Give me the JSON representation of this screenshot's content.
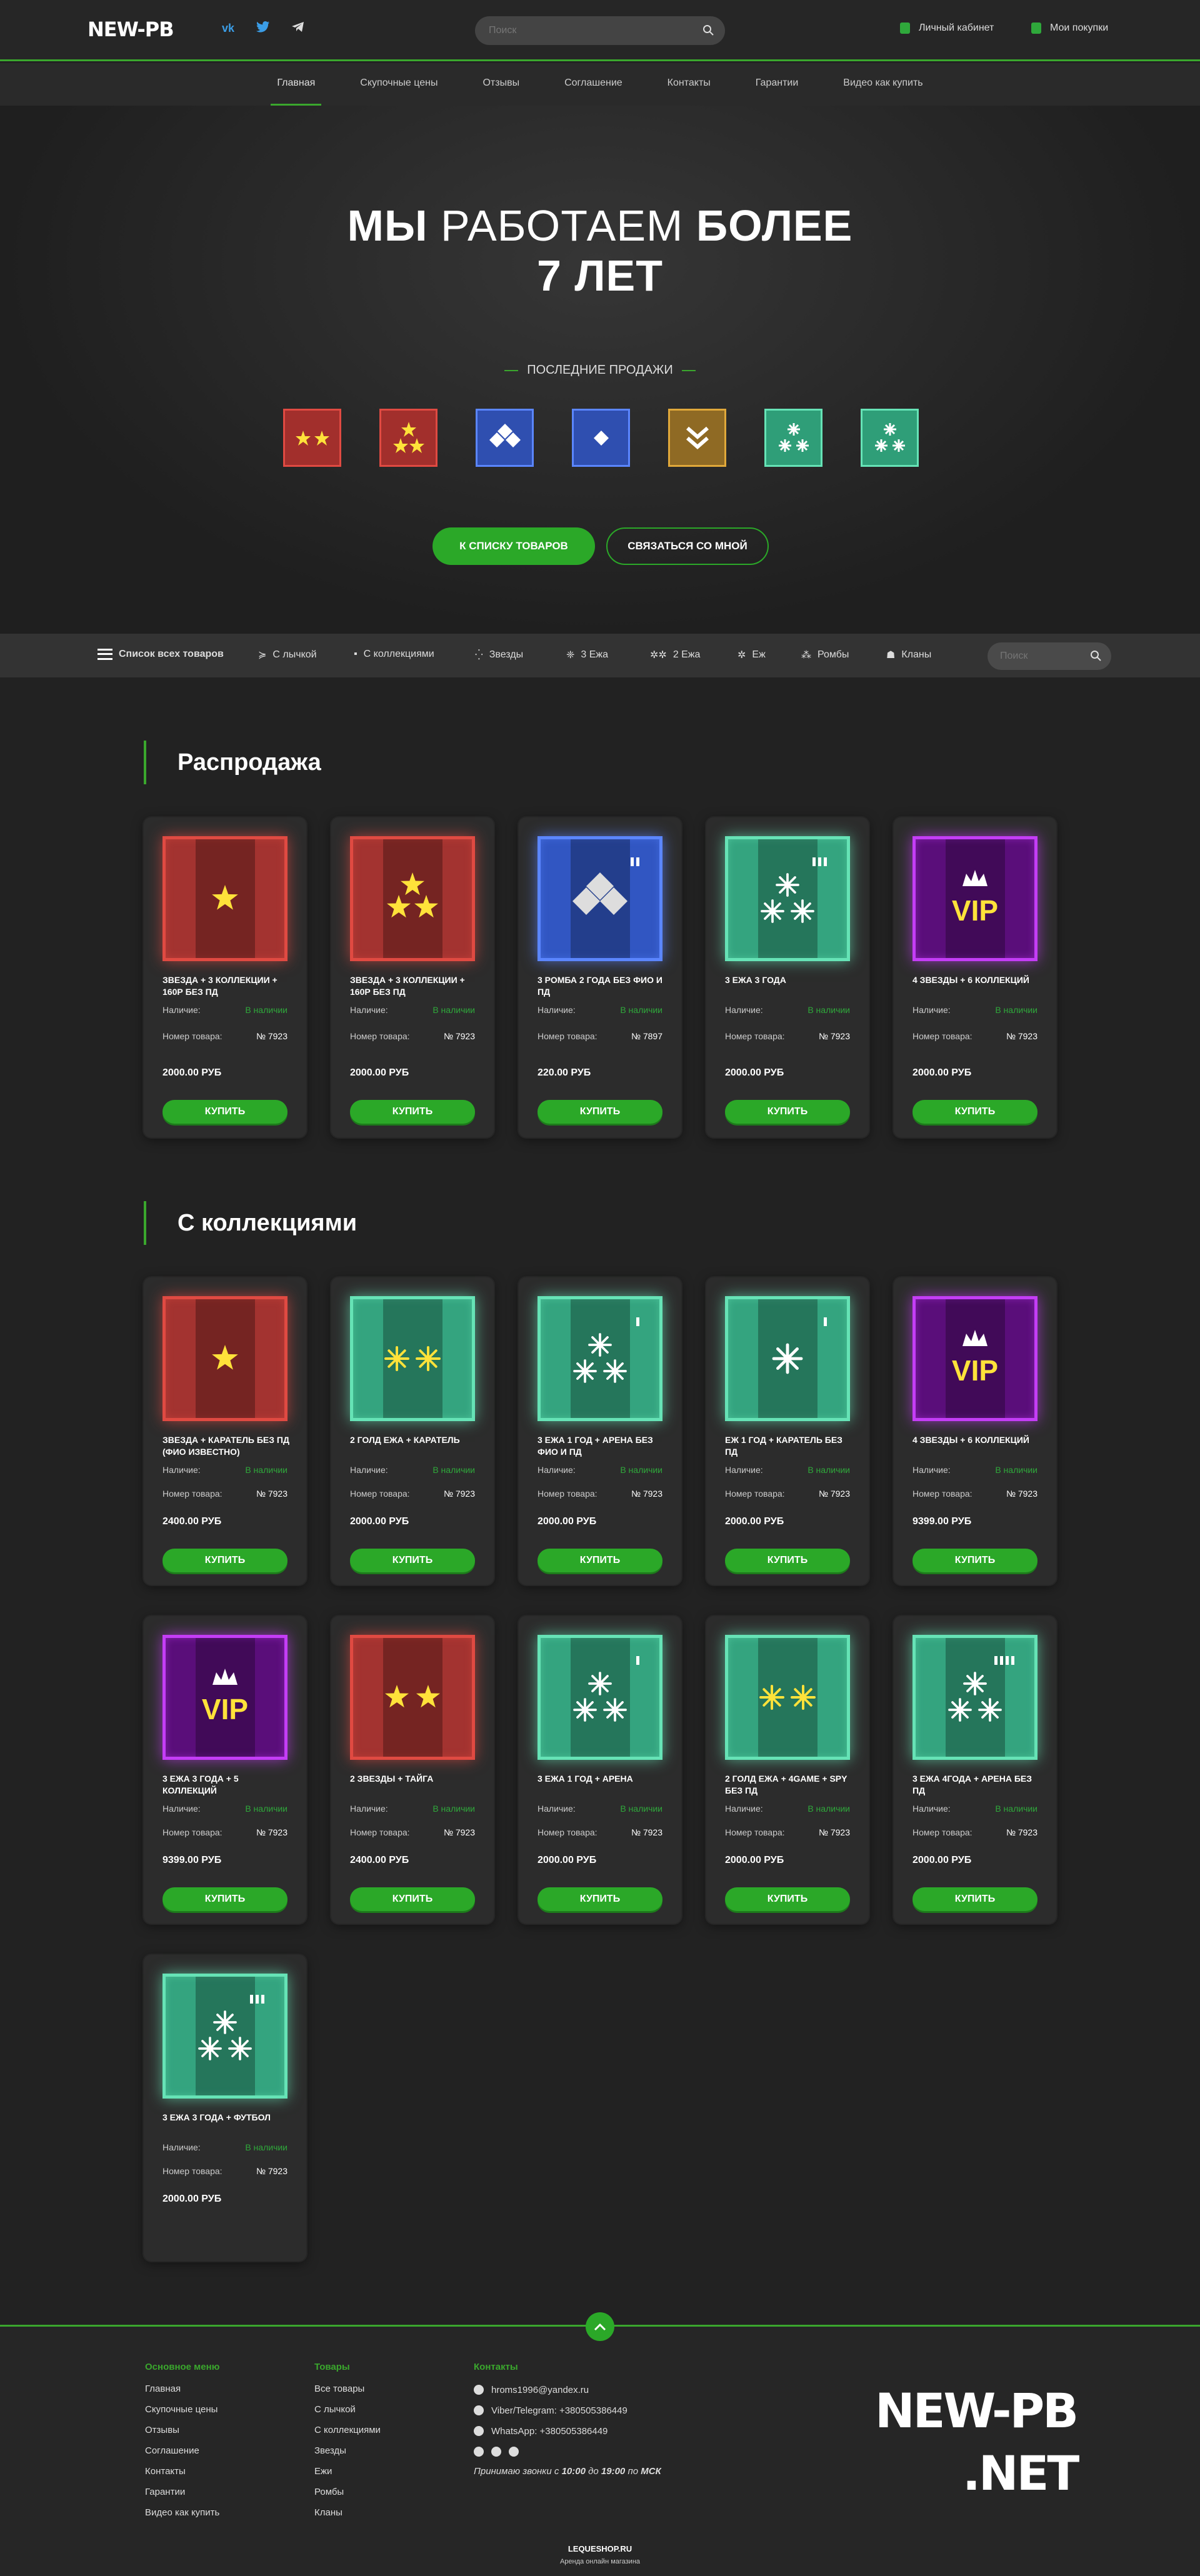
{
  "header": {
    "logo": "NEW-PB",
    "search_placeholder": "Поиск",
    "account": "Личный кабинет",
    "purchases": "Мои покупки"
  },
  "nav": [
    "Главная",
    "Скупочные цены",
    "Отзывы",
    "Соглашение",
    "Контакты",
    "Гарантии",
    "Видео как купить"
  ],
  "hero": {
    "line1_a": "МЫ",
    "line1_b": " РАБОТАЕМ ",
    "line1_c": "БОЛЕЕ",
    "line2": "7 ЛЕТ",
    "sales_title": "ПОСЛЕДНИЕ ПРОДАЖИ",
    "btn_catalog": "К СПИСКУ ТОВАРОВ",
    "btn_contact": "СВЯЗАТЬСЯ СО МНОЙ"
  },
  "categories": {
    "all": "Список всех товаров",
    "items": [
      "С лычкой",
      "С коллекциями",
      "Звезды",
      "3 Ежа",
      "2 Ежа",
      "Еж",
      "Ромбы",
      "Кланы"
    ],
    "search_placeholder": "Поиск"
  },
  "sections": {
    "sale": "Распродажа",
    "collections": "С коллекциями"
  },
  "labels": {
    "availability": "Наличие:",
    "in_stock": "В наличии",
    "item_no": "Номер товара:",
    "buy": "КУПИТЬ"
  },
  "sale_cards": [
    {
      "name": "ЗВЕЗДА + 3 КОЛЛЕКЦИИ + 160Р БЕЗ ПД",
      "num": "№ 7923",
      "price": "2000.00 РУБ"
    },
    {
      "name": "ЗВЕЗДА + 3 КОЛЛЕКЦИИ + 160Р БЕЗ ПД",
      "num": "№ 7923",
      "price": "2000.00 РУБ"
    },
    {
      "name": "3 РОМБА 2 ГОДА БЕЗ ФИО И ПД",
      "num": "№ 7897",
      "price": "220.00 РУБ"
    },
    {
      "name": "3 ЕЖА 3 ГОДА",
      "num": "№ 7923",
      "price": "2000.00 РУБ"
    },
    {
      "name": "4 ЗВЕЗДЫ + 6 КОЛЛЕКЦИЙ",
      "num": "№ 7923",
      "price": "2000.00 РУБ"
    }
  ],
  "collection_cards": [
    {
      "name": "ЗВЕЗДА + КАРАТЕЛЬ БЕЗ ПД (ФИО ИЗВЕСТНО)",
      "num": "№ 7923",
      "price": "2400.00 РУБ"
    },
    {
      "name": "2 ГОЛД ЕЖА + КАРАТЕЛЬ",
      "num": "№ 7923",
      "price": "2000.00 РУБ"
    },
    {
      "name": "3 ЕЖА 1 ГОД + АРЕНА БЕЗ ФИО И ПД",
      "num": "№ 7923",
      "price": "2000.00 РУБ"
    },
    {
      "name": "ЕЖ 1 ГОД + КАРАТЕЛЬ БЕЗ ПД",
      "num": "№ 7923",
      "price": "2000.00 РУБ"
    },
    {
      "name": "4 ЗВЕЗДЫ + 6 КОЛЛЕКЦИЙ",
      "num": "№ 7923",
      "price": "9399.00 РУБ"
    },
    {
      "name": "3 ЕЖА 3 ГОДА + 5 КОЛЛЕКЦИЙ",
      "num": "№ 7923",
      "price": "9399.00 РУБ"
    },
    {
      "name": "2 ЗВЕЗДЫ + ТАЙГА",
      "num": "№ 7923",
      "price": "2400.00 РУБ"
    },
    {
      "name": "3 ЕЖА 1 ГОД + АРЕНА",
      "num": "№ 7923",
      "price": "2000.00 РУБ"
    },
    {
      "name": "2 ГОЛД ЕЖА + 4GAME + SPY БЕЗ ПД",
      "num": "№ 7923",
      "price": "2000.00 РУБ"
    },
    {
      "name": "3 ЕЖА 4ГОДА + АРЕНА БЕЗ ПД",
      "num": "№ 7923",
      "price": "2000.00 РУБ"
    },
    {
      "name": "3 ЕЖА 3 ГОДА + ФУТБОЛ",
      "num": "№ 7923",
      "price": "2000.00 РУБ"
    }
  ],
  "footer": {
    "menu_title": "Основное меню",
    "menu": [
      "Главная",
      "Скупочные цены",
      "Отзывы",
      "Соглашение",
      "Контакты",
      "Гарантии",
      "Видео как купить"
    ],
    "goods_title": "Товары",
    "goods": [
      "Все товары",
      "С лычкой",
      "С коллекциями",
      "Звезды",
      "Ежи",
      "Ромбы",
      "Кланы"
    ],
    "contacts_title": "Контакты",
    "email": "hroms1996@yandex.ru",
    "viber": "Viber/Telegram: +380505386449",
    "whatsapp": "WhatsApp: +380505386449",
    "hours_a": "Принимаю звонки с ",
    "hours_b": "10:00",
    "hours_c": " до ",
    "hours_d": "19:00",
    "hours_e": " по ",
    "hours_f": "МСК",
    "brand1": "NEW-PB",
    "brand2": ".NET",
    "lequeshop": "LEQUESHOP.RU",
    "lequeshop_sub": "Аренда онлайн магазина"
  },
  "colors": {
    "accent": "#3aa72d",
    "red": "#e04a42",
    "blue": "#3d66d6",
    "green": "#43c79b",
    "gold": "#e0a83a",
    "purple": "#a422d8"
  }
}
